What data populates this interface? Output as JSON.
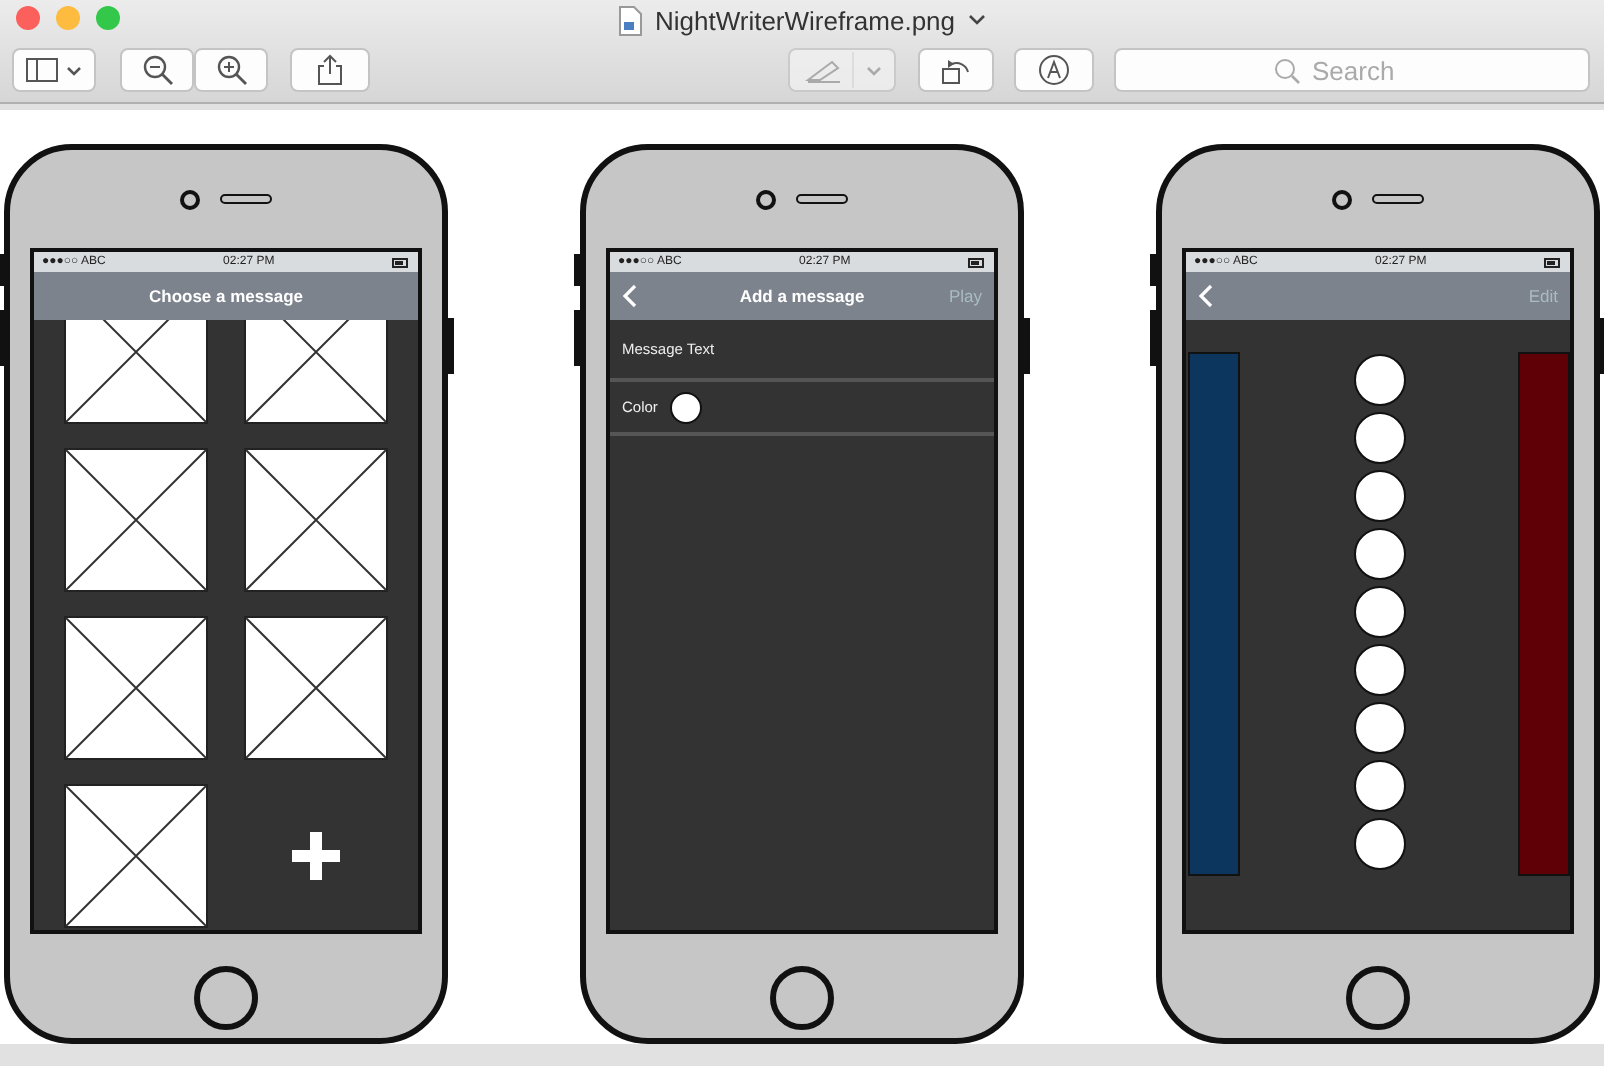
{
  "window": {
    "title": "NightWriterWireframe.png"
  },
  "toolbar": {
    "search": {
      "placeholder": "Search"
    },
    "markup_disabled": true
  },
  "phones": [
    {
      "kind": "grid",
      "status": {
        "carrier": "●●●○○ ABC",
        "time": "02:27 PM"
      },
      "nav": {
        "back": false,
        "title": "Choose a message"
      },
      "tiles": [
        {
          "kind": "picture"
        },
        {
          "kind": "picture"
        },
        {
          "kind": "picture"
        },
        {
          "kind": "picture"
        },
        {
          "kind": "picture"
        },
        {
          "kind": "picture"
        },
        {
          "kind": "picture"
        },
        {
          "kind": "add"
        }
      ]
    },
    {
      "kind": "form",
      "status": {
        "carrier": "●●●○○ ABC",
        "time": "02:27 PM"
      },
      "nav": {
        "back": true,
        "title": "Add a message",
        "action": "Play"
      },
      "rows": [
        {
          "kind": "text",
          "label": "Message Text"
        },
        {
          "kind": "color",
          "label": "Color",
          "color": "#ffffff"
        }
      ]
    },
    {
      "kind": "player",
      "status": {
        "carrier": "●●●○○ ABC",
        "time": "02:27 PM"
      },
      "nav": {
        "back": true,
        "action": "Edit"
      },
      "side_bars": [
        {
          "color": "#0c365e"
        },
        {
          "color": "#5e0006"
        }
      ],
      "dots": [
        {
          "kind": "circle"
        },
        {
          "kind": "circle"
        },
        {
          "kind": "circle"
        },
        {
          "kind": "circle"
        },
        {
          "kind": "circle"
        },
        {
          "kind": "circle"
        },
        {
          "kind": "circle"
        },
        {
          "kind": "circle"
        },
        {
          "kind": "circle"
        }
      ]
    }
  ]
}
